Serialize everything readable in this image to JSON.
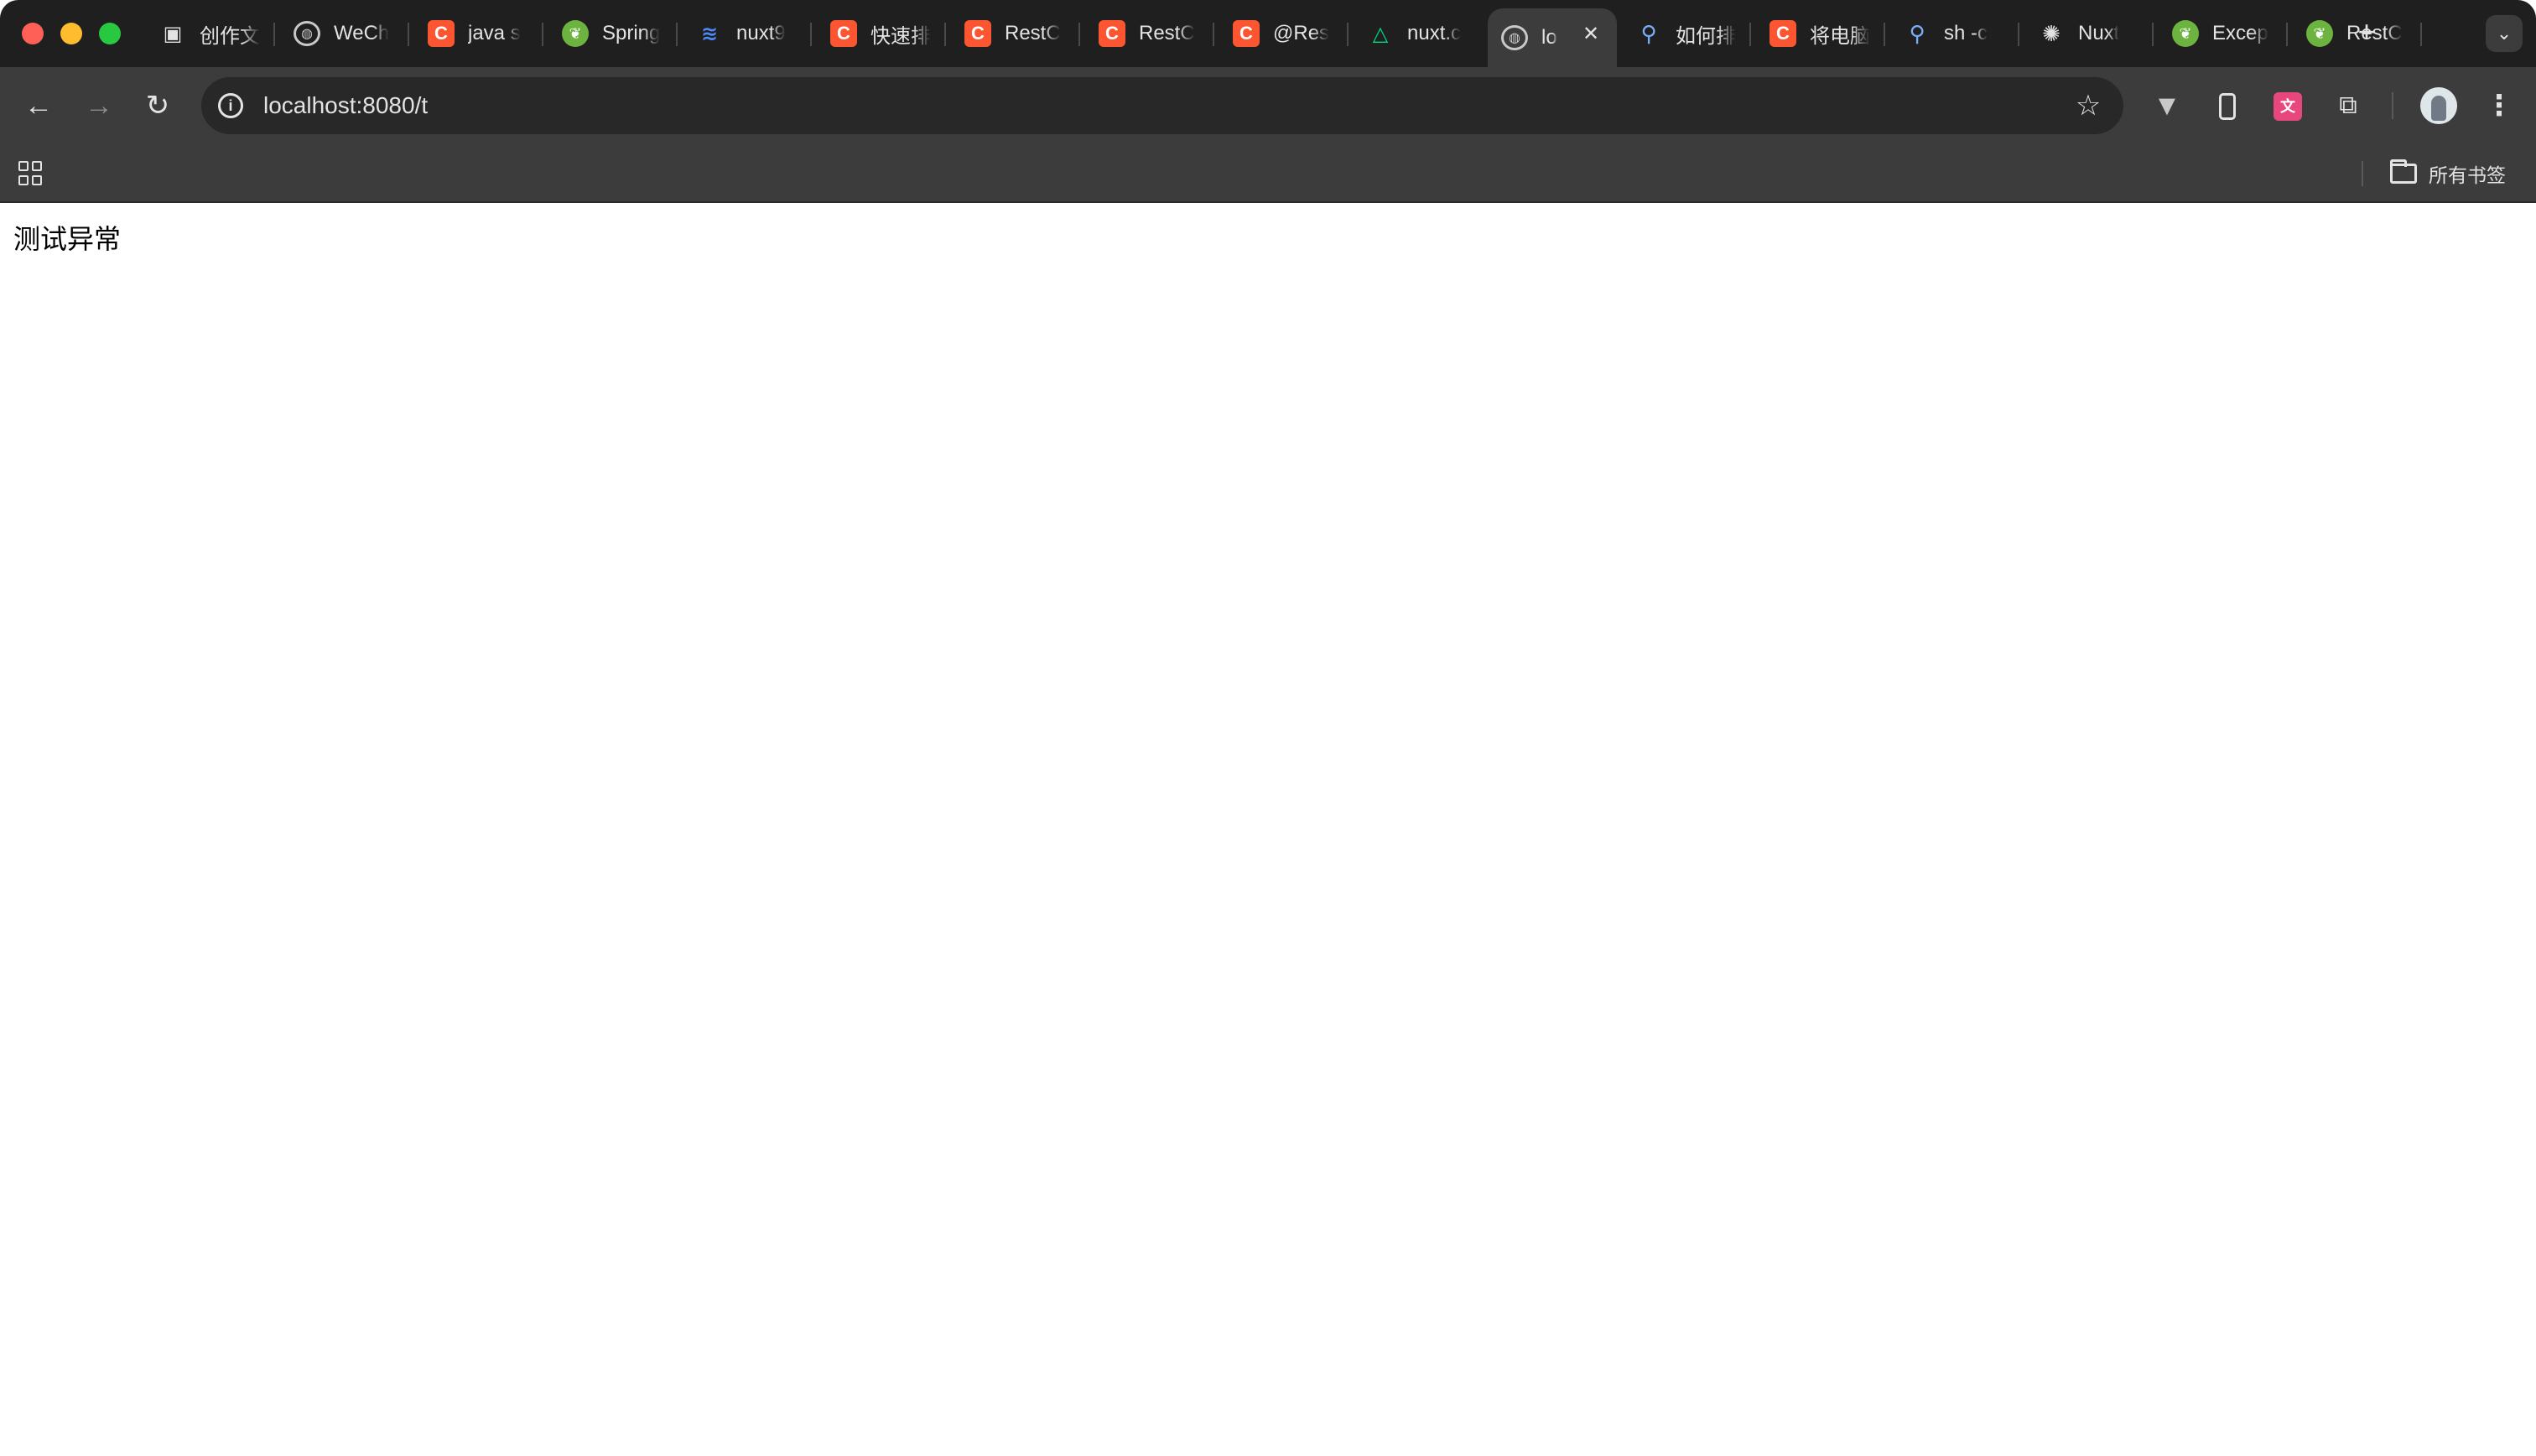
{
  "window": {
    "tabs": [
      {
        "title": "创作文",
        "favicon": "robot-icon"
      },
      {
        "title": "WeCh",
        "favicon": "globe-icon"
      },
      {
        "title": "java s",
        "favicon": "csdn-icon"
      },
      {
        "title": "Spring",
        "favicon": "spring-icon"
      },
      {
        "title": "nuxt9",
        "favicon": "layers-icon"
      },
      {
        "title": "快速排",
        "favicon": "csdn-icon"
      },
      {
        "title": "RestC",
        "favicon": "csdn-icon"
      },
      {
        "title": "RestC",
        "favicon": "csdn-icon"
      },
      {
        "title": "@Res",
        "favicon": "csdn-icon"
      },
      {
        "title": "nuxt.c",
        "favicon": "nuxt-icon"
      },
      {
        "title": "lo",
        "favicon": "globe-icon",
        "active": true
      },
      {
        "title": "如何排",
        "favicon": "search-icon"
      },
      {
        "title": "将电脑",
        "favicon": "csdn-icon"
      },
      {
        "title": "sh -c",
        "favicon": "search-icon"
      },
      {
        "title": "Nuxt",
        "favicon": "openai-icon"
      },
      {
        "title": "Excep",
        "favicon": "spring-icon"
      },
      {
        "title": "RestC",
        "favicon": "spring-icon"
      }
    ],
    "new_tab_label": "+",
    "tab_search_label": "⌄"
  },
  "toolbar": {
    "url": "localhost:8080/t"
  },
  "bookmarks": {
    "all_bookmarks_label": "所有书签"
  },
  "page": {
    "text": "测试异常"
  },
  "colors": {
    "tabstrip_bg": "#1f1f20",
    "toolbar_bg": "#3c3c3c",
    "omnibox_bg": "#282828",
    "csdn_red": "#fc5531",
    "spring_green": "#6db33f"
  }
}
